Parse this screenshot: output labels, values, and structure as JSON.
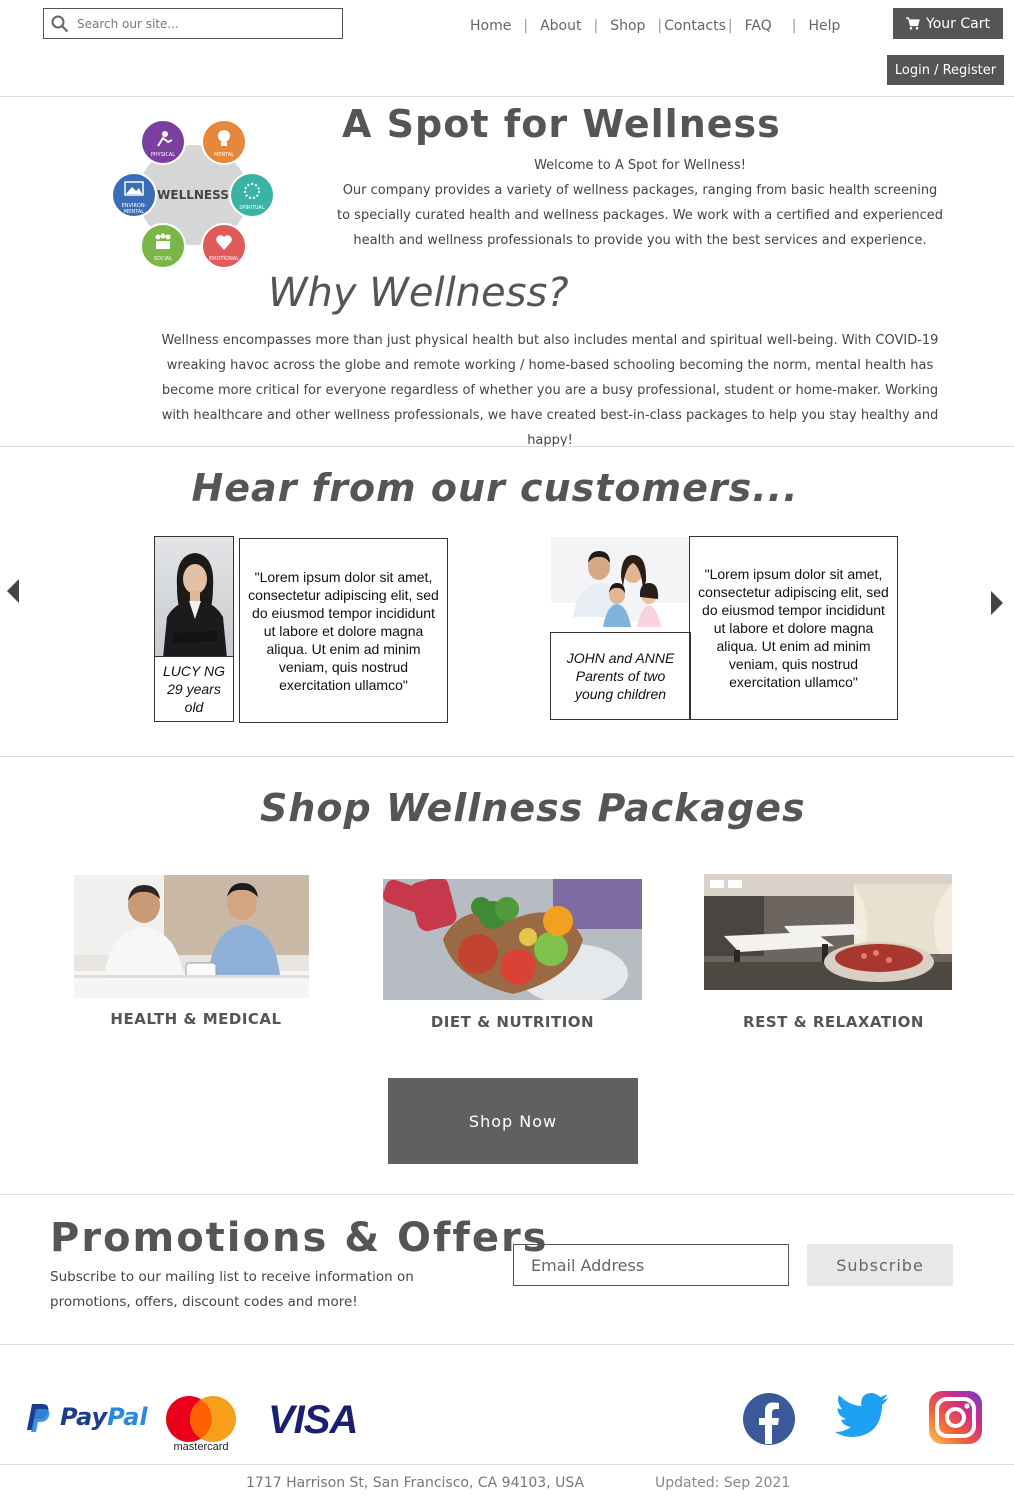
{
  "header": {
    "search_placeholder": "Search our site...",
    "nav": [
      "Home",
      "About",
      "Shop",
      "Contacts",
      "FAQ",
      "Help"
    ],
    "cart_label": "Your Cart",
    "login_label": "Login / Register"
  },
  "intro": {
    "wheel_center": "WELLNESS",
    "wheel_labels": [
      "PHYSICAL",
      "MENTAL",
      "SPIRITUAL",
      "EMOTIONAL",
      "SOCIAL",
      "ENVIRON-\nMENTAL"
    ],
    "title": "A Spot for Wellness",
    "welcome": "Welcome to A Spot for Wellness!",
    "text": "Our company provides a variety of wellness packages, ranging from basic health screening to specially curated health and wellness packages. We work with a certified and experienced health and wellness professionals to provide you with the best services and experience."
  },
  "why": {
    "title": "Why Wellness?",
    "text": "Wellness encompasses more than just physical health but also includes mental and spiritual well-being. With COVID-19 wreaking havoc across the globe and remote working / home-based schooling becoming the norm, mental health has become more critical for everyone regardless of whether you are a busy professional, student or home-maker. Working with healthcare and other wellness professionals, we have created best-in-class packages to help you stay healthy and happy!"
  },
  "testimonials": {
    "title": "Hear from our customers...",
    "items": [
      {
        "name_line1": "LUCY NG",
        "name_line2": "29 years",
        "name_line3": "old",
        "quote": "\"Lorem ipsum dolor sit amet, consectetur adipiscing elit, sed do eiusmod tempor incididunt ut labore et dolore magna aliqua. Ut enim ad minim veniam, quis nostrud exercitation ullamco\""
      },
      {
        "name_line1": "JOHN and ANNE",
        "name_line2": "Parents of two",
        "name_line3": "young children",
        "quote": "\"Lorem ipsum dolor sit amet, consectetur adipiscing elit, sed do eiusmod tempor incididunt ut labore et dolore magna aliqua. Ut enim ad minim veniam, quis nostrud exercitation ullamco\""
      }
    ]
  },
  "shop": {
    "title": "Shop Wellness Packages",
    "packages": [
      "HEALTH & MEDICAL",
      "DIET & NUTRITION",
      "REST & RELAXATION"
    ],
    "button": "Shop Now"
  },
  "promo": {
    "title": "Promotions & Offers",
    "text": "Subscribe to our mailing list to receive information on promotions, offers, discount codes and more!",
    "email_placeholder": "Email Address",
    "subscribe": "Subscribe"
  },
  "footer": {
    "paypal_pay": "Pay",
    "paypal_pal": "Pal",
    "mastercard": "mastercard",
    "visa": "VISA",
    "address": "1717 Harrison St, San Francisco, CA 94103, USA",
    "updated": "Updated: Sep 2021"
  },
  "colors": {
    "button_dark": "#555555",
    "physical": "#7b3fa0",
    "mental": "#e8873a",
    "spiritual": "#3bb3a4",
    "emotional": "#e05a5a",
    "social": "#7ab648",
    "environmental": "#3a6db5"
  }
}
